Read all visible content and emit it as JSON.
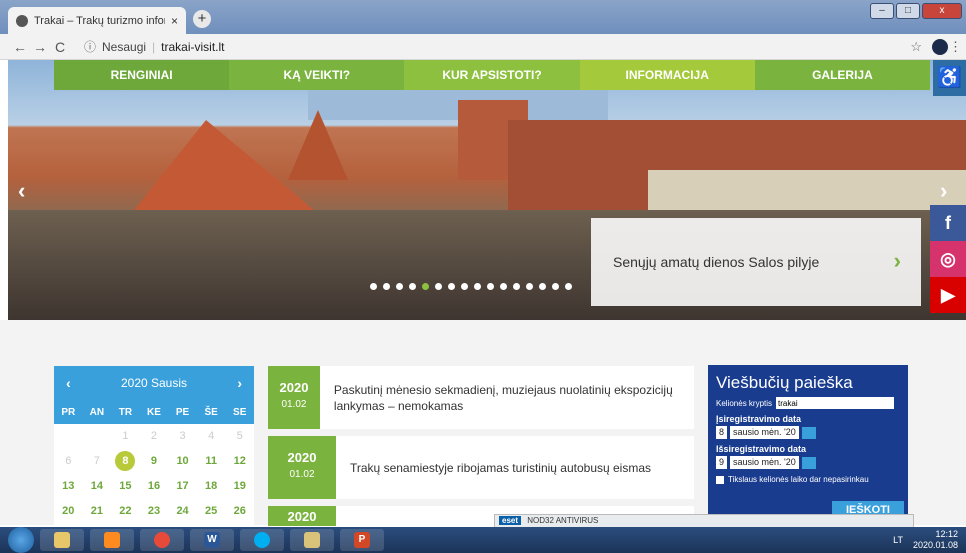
{
  "browser": {
    "tab_title": "Trakai – Trakų turizmo informac",
    "tab_close": "×",
    "new_tab": "+",
    "back": "←",
    "forward": "→",
    "reload": "C",
    "security_icon": "ⓘ",
    "security_label": "Nesaugi",
    "separator": "|",
    "url": "trakai-visit.lt",
    "bookmark_icon": "☆",
    "menu_icon": "⋮",
    "window_minimize": "–",
    "window_maximize": "□",
    "window_close": "x"
  },
  "nav": {
    "items": [
      "RENGINIAI",
      "KĄ VEIKTI?",
      "KUR APSISTOTI?",
      "INFORMACIJA",
      "GALERIJA"
    ],
    "accessibility_icon": "♿"
  },
  "hero": {
    "caption": "Senųjų amatų dienos Salos pilyje",
    "prev": "‹",
    "next": "›",
    "caption_arrow": "›",
    "slide_count": 16,
    "active_slide": 4
  },
  "social": {
    "facebook": "f",
    "instagram": "◎",
    "youtube": "▶"
  },
  "calendar": {
    "title": "2020 Sausis",
    "prev": "‹",
    "next": "›",
    "weekdays": [
      "PR",
      "AN",
      "TR",
      "KE",
      "PE",
      "ŠE",
      "SE"
    ],
    "rows": [
      [
        "",
        "",
        "1",
        "2",
        "3",
        "4",
        "5"
      ],
      [
        "6",
        "7",
        "8",
        "9",
        "10",
        "11",
        "12"
      ],
      [
        "13",
        "14",
        "15",
        "16",
        "17",
        "18",
        "19"
      ],
      [
        "20",
        "21",
        "22",
        "23",
        "24",
        "25",
        "26"
      ]
    ],
    "today": "8"
  },
  "events": [
    {
      "year": "2020",
      "date": "01.02",
      "text": "Paskutinį mėnesio sekmadienį, muziejaus nuolatinių ekspozicijų lankymas – nemokamas"
    },
    {
      "year": "2020",
      "date": "01.02",
      "text": "Trakų senamiestyje ribojamas turistinių autobusų eismas"
    },
    {
      "year": "2020",
      "date": "",
      "text": ""
    }
  ],
  "hotel_search": {
    "title": "Viešbučių paieška",
    "destination_label": "Kelionės kryptis",
    "destination_value": "trakai",
    "checkin_label": "Įsiregistravimo data",
    "checkin_day": "8",
    "checkin_month": "sausio mėn. '20",
    "checkout_label": "Išsiregistravimo data",
    "checkout_day": "9",
    "checkout_month": "sausio mėn. '20",
    "flexible_label": "Tikslaus kelionės laiko dar nepasirinkau",
    "search_button": "IEŠKOTI"
  },
  "eset": {
    "badge": "eset",
    "label": "NOD32 ANTIVIRUS"
  },
  "taskbar": {
    "apps": [
      "",
      "",
      "",
      "W",
      "",
      "",
      "P"
    ],
    "lang": "LT",
    "time": "12:12",
    "date": "2020.01.08"
  },
  "colors": {
    "green": "#7bb33f",
    "blue": "#3aa0dc",
    "navy": "#1a3c8f"
  }
}
